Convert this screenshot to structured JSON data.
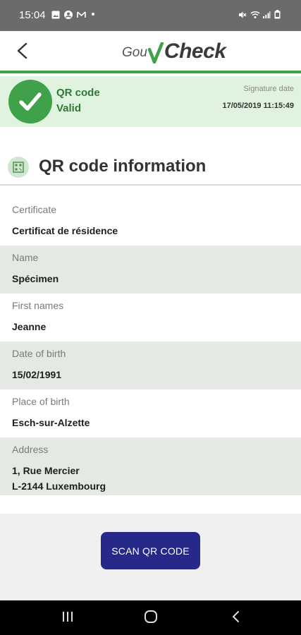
{
  "status_bar": {
    "time": "15:04",
    "icons_left": [
      "image-icon",
      "account-icon",
      "mail-icon",
      "dot-icon"
    ],
    "icons_right": [
      "mute-icon",
      "wifi-icon",
      "signal-icon",
      "battery-icon"
    ]
  },
  "header": {
    "logo_prefix": "Gou",
    "logo_main": "Check",
    "accent_color": "#3fa14a"
  },
  "banner": {
    "status_line1": "QR code",
    "status_line2": "Valid",
    "signature_label": "Signature date",
    "signature_value": "17/05/2019 11:15:49",
    "background": "#dff3de"
  },
  "section": {
    "title": "QR code information"
  },
  "fields": [
    {
      "label": "Certificate",
      "value": "Certificat de résidence"
    },
    {
      "label": "Name",
      "value": "Spécimen"
    },
    {
      "label": "First names",
      "value": "Jeanne"
    },
    {
      "label": "Date of birth",
      "value": "15/02/1991"
    },
    {
      "label": "Place of birth",
      "value": "Esch-sur-Alzette"
    },
    {
      "label": "Address",
      "value": "1, Rue Mercier\nL-2144 Luxembourg"
    }
  ],
  "actions": {
    "scan_label": "SCAN QR CODE",
    "button_color": "#262988"
  },
  "nav": {
    "items": [
      "recents-icon",
      "home-icon",
      "back-icon"
    ]
  }
}
